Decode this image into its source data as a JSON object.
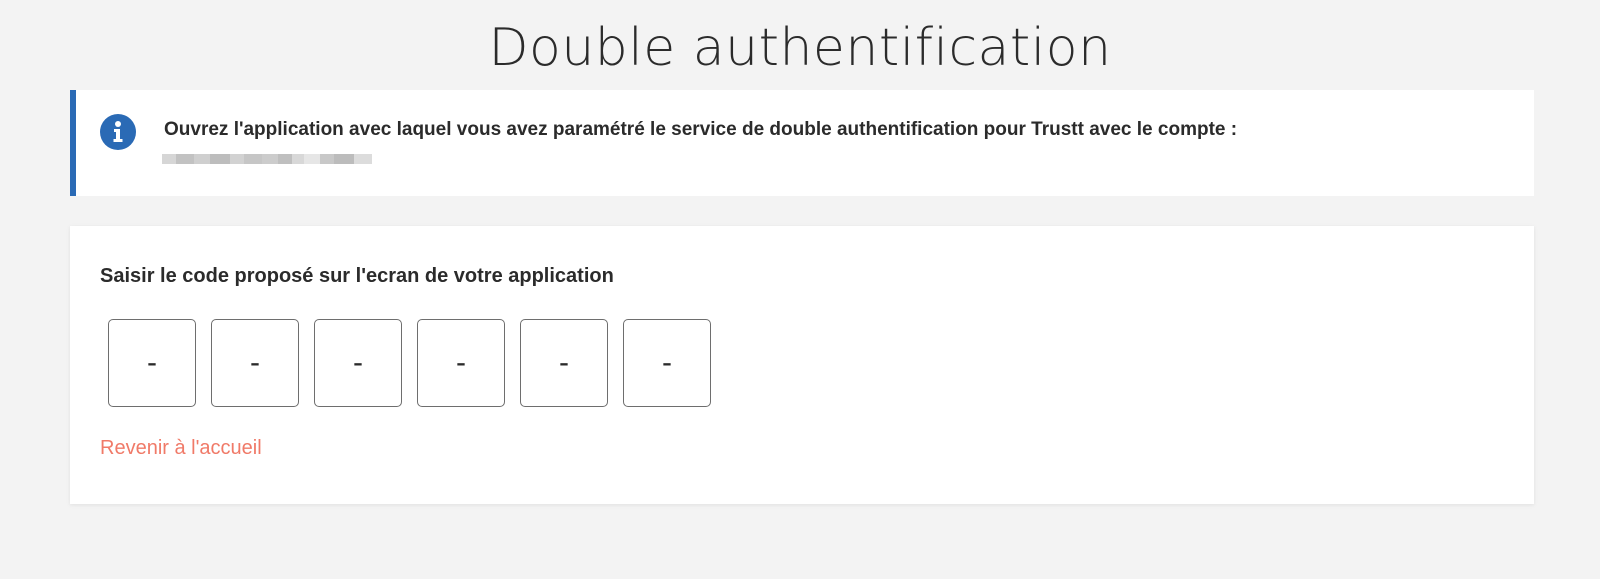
{
  "page": {
    "title": "Double authentification"
  },
  "info": {
    "icon": "info-icon",
    "message": "Ouvrez l'application avec laquel vous avez paramétré le service de double authentification pour Trustt avec le compte :",
    "accent_color": "#2a6ab5"
  },
  "code_entry": {
    "label": "Saisir le code proposé sur l'ecran de votre application",
    "digits": [
      {
        "placeholder": "-",
        "value": ""
      },
      {
        "placeholder": "-",
        "value": ""
      },
      {
        "placeholder": "-",
        "value": ""
      },
      {
        "placeholder": "-",
        "value": ""
      },
      {
        "placeholder": "-",
        "value": ""
      },
      {
        "placeholder": "-",
        "value": ""
      }
    ]
  },
  "back_link": {
    "label": "Revenir à l'accueil",
    "color": "#f07a68"
  }
}
